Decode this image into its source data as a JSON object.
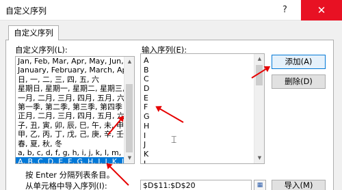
{
  "window": {
    "title": "自定义序列",
    "help_label": "?",
    "close_label": "✕"
  },
  "tab": {
    "label": "自定义序列"
  },
  "custom_lists": {
    "label": "自定义序列(L):",
    "items": [
      "Jan, Feb, Mar, Apr, May, Jun, Ju",
      "January, February, March, April",
      "日, 一, 二, 三, 四, 五, 六",
      "星期日, 星期一, 星期二, 星期三, 星",
      "一月, 二月, 三月, 四月, 五月, 六月",
      "第一季, 第二季, 第三季, 第四季",
      "正月, 二月, 三月, 四月, 五月, 六月",
      "子, 丑, 寅, 卯, 辰, 巳, 午, 未, 申, 酉",
      "甲, 乙, 丙, 丁, 戊, 己, 庚, 辛, 壬, 癸",
      "春, 夏, 秋, 冬",
      "a, b, c, d, f, g, h, i, j, k, l, m, n, o",
      "A, B, C, D, E, F, G, H, I, J, K, L, M"
    ],
    "selected_index": 11
  },
  "input_list": {
    "label": "输入序列(E):",
    "items": [
      "A",
      "B",
      "C",
      "D",
      "E",
      "F",
      "G",
      "H",
      "I",
      "J",
      "K",
      "L"
    ]
  },
  "buttons": {
    "add": "添加(A)",
    "delete": "删除(D)",
    "import": "导入(M)"
  },
  "hint": "按 Enter 分隔列表条目。",
  "import": {
    "label": "从单元格中导入序列(I):",
    "range": "$D$11:$D$20",
    "ref_icon": "▦"
  },
  "accent_color": "#0078d7",
  "annotation_color": "#e60000"
}
